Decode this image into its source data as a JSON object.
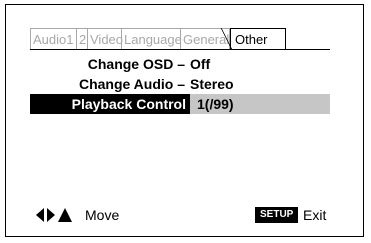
{
  "tabs": [
    {
      "label": "Audio1"
    },
    {
      "label": "2"
    },
    {
      "label": "Video"
    },
    {
      "label": "Language"
    },
    {
      "label": "General"
    },
    {
      "label": "Other"
    }
  ],
  "settings": {
    "change_osd": {
      "label": "Change OSD –",
      "value": "Off"
    },
    "change_audio": {
      "label": "Change Audio –",
      "value": "Stereo"
    },
    "playback_control": {
      "label": "Playback Control",
      "value": "1(/99)"
    }
  },
  "footer": {
    "move_label": "Move",
    "setup_label": "SETUP",
    "exit_label": "Exit",
    "arrow_icons": [
      "arrow-left-icon",
      "arrow-right-icon",
      "arrow-up-icon"
    ]
  },
  "colors": {
    "inactive_tab": "#a8a8a8",
    "selected_value_bg": "#c6c6c6",
    "highlight_bg": "#000000",
    "highlight_fg": "#ffffff"
  }
}
